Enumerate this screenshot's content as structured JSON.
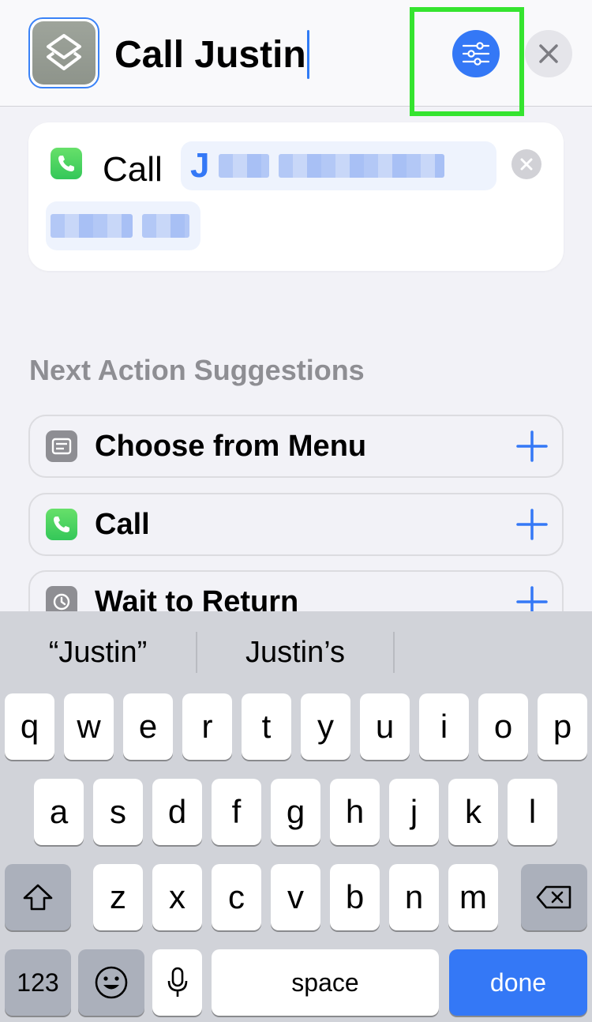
{
  "header": {
    "title": "Call Justin"
  },
  "action_card": {
    "verb": "Call",
    "contact_initial": "J"
  },
  "suggestions": {
    "title": "Next Action Suggestions",
    "items": [
      {
        "label": "Choose from Menu",
        "icon": "menu-icon"
      },
      {
        "label": "Call",
        "icon": "phone-icon"
      },
      {
        "label": "Wait to Return",
        "icon": "history-icon"
      }
    ]
  },
  "keyboard": {
    "predictions": [
      "“Justin”",
      "Justin’s"
    ],
    "row1": [
      "q",
      "w",
      "e",
      "r",
      "t",
      "y",
      "u",
      "i",
      "o",
      "p"
    ],
    "row2": [
      "a",
      "s",
      "d",
      "f",
      "g",
      "h",
      "j",
      "k",
      "l"
    ],
    "row3": [
      "z",
      "x",
      "c",
      "v",
      "b",
      "n",
      "m"
    ],
    "numbers_label": "123",
    "space_label": "space",
    "done_label": "done"
  },
  "colors": {
    "accent": "#3478f6",
    "highlight": "#35e42f",
    "phone_green": "#34c759"
  }
}
